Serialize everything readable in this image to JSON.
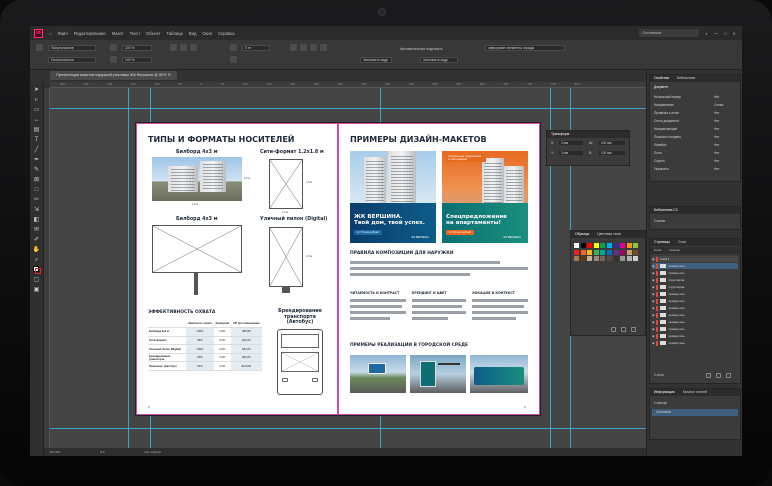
{
  "app": {
    "logo_text": "Id",
    "menu": [
      "Файл",
      "Редактирование",
      "Макет",
      "Текст",
      "Объект",
      "Таблица",
      "Вид",
      "Окно",
      "Справка"
    ],
    "workspace": "Основные"
  },
  "control_bar": {
    "field1": "Полуполосное",
    "field2": "Полуполосное",
    "check1": "Автоматически подгонять",
    "check2": "Заполнить кадр",
    "size_field": "Заполнить кадр",
    "stroke_field": "0 пт",
    "percent": "100 %",
    "frame_label": "сверхузкие элементы ограды"
  },
  "document": {
    "tab_title": "Презентация макетов наружной рекламы ЖК Вершина @ 50%",
    "ruler_ticks": [
      "300",
      "250",
      "200",
      "150",
      "100",
      "50",
      "0",
      "50",
      "100",
      "150",
      "200",
      "250",
      "300",
      "350",
      "400",
      "450",
      "500",
      "550",
      "600",
      "650",
      "700",
      "750",
      "800"
    ]
  },
  "left_page": {
    "title": "ТИПЫ И ФОРМАТЫ НОСИТЕЛЕЙ",
    "billboard_1": "Билборд 4x3 м",
    "city_format": "Сити-формат 1.2x1.8 м",
    "billboard_2": "Билборд 4x3 м",
    "street_pylon": "Уличный пилон (Digital)",
    "dim_1": "4,0 м",
    "dim_2": "3,0 м",
    "dim_3": "1,2 м",
    "dim_4": "1,8 м",
    "dim_5": "1,2 м",
    "dim_6": "1,8 м",
    "efficiency_title": "ЭФФЕКТИВНОСТЬ ОХВАТА",
    "transport_title": "Брендирование транспорта (Автобус)",
    "table": {
      "headers": [
        "",
        "Заметность охвата",
        "Конверсия",
        "CPI при охватывании"
      ],
      "rows": [
        [
          "Билборд 6x3 м",
          "100%",
          "0,8%",
          "$55,88"
        ],
        [
          "Сити-формат",
          "55%",
          "0,6%",
          "$12,00"
        ],
        [
          "Уличный пилон (Digital)",
          "100%",
          "0,6%",
          "$54,00"
        ],
        [
          "Брендирование транспорта",
          "50%",
          "0,4%",
          "$34,00"
        ],
        [
          "Транспорт (Автобус)",
          "51%",
          "0,4%",
          "$110,00"
        ]
      ]
    },
    "page_number": "8"
  },
  "right_page": {
    "title": "ПРИМЕРЫ ДИЗАЙН-МАКЕТОВ",
    "poster_1_title": "ЖК ВЕРШИНА.\nТвой дом, твой успех.",
    "poster_1_sub": "от 7,5 млн рублей",
    "poster_1_logo": "ЖК ВЕРШИНА",
    "poster_2_tag": "Специальное предложение от застройщика",
    "poster_2_title": "Спецпредложение\nна апартаменты!",
    "poster_2_sub": "от 4,5 млн рублей",
    "poster_2_logo": "ЖК ВЕРШИНА",
    "rules_title": "ПРАВИЛА КОМПОЗИЦИИ ДЛЯ НАРУЖКИ",
    "col_1": "ЧИТАЕМОСТЬ И КОНТРАСТ",
    "col_2": "БРЕНДИНГ И ЦВЕТ",
    "col_3": "ЛОКАЦИЯ И КОНТЕКСТ",
    "city_title": "ПРИМЕРЫ РЕАЛИЗАЦИИ В ГОРОДСКОЙ СРЕДЕ",
    "page_number": "9"
  },
  "status": {
    "zoom": "50,18%",
    "page": "8-9",
    "preflight": "Нет ошибок"
  },
  "transform_panel": {
    "title": "Трансформ.",
    "x_label": "X:",
    "x_value": "3 мм",
    "y_label": "Y:",
    "y_value": "3 мм",
    "w_label": "Ш:",
    "w_value": "100 мм",
    "h_label": "В:",
    "h_value": "100 мм"
  },
  "swatches_panel": {
    "tab_1": "Образцы",
    "tab_2": "Цветовая тема",
    "colors": [
      "#ffffff",
      "#000000",
      "#ff0000",
      "#ffff00",
      "#00a651",
      "#00aeef",
      "#2e3192",
      "#ec008c",
      "#f7941d",
      "#8dc63f",
      "#ee1d23",
      "#f26522",
      "#fdb813",
      "#39b54a",
      "#00a99d",
      "#0072bc",
      "#662d91",
      "#9e005d",
      "#c69c6d",
      "#754c24",
      "#a67c52",
      "#603913",
      "#c7b299",
      "#998675",
      "#736357",
      "#534741",
      "#362f2d",
      "#959595",
      "#b2b2b2",
      "#d0d0d0"
    ]
  },
  "properties_panel": {
    "tabs": [
      "Свойства",
      "Библиотеки"
    ],
    "section": "Документ",
    "rows": [
      {
        "label": "Начальный номер",
        "value": "Нет"
      },
      {
        "label": "Направление",
        "value": "Слева"
      },
      {
        "label": "Привязка к сетке",
        "value": "Нет"
      },
      {
        "label": "Сетка документа",
        "value": "Нет"
      },
      {
        "label": "Направляющие",
        "value": "Нет"
      },
      {
        "label": "Показать направл.",
        "value": "Нет"
      },
      {
        "label": "Линейки",
        "value": "Нет"
      },
      {
        "label": "Поля",
        "value": "Нет"
      },
      {
        "label": "Скрыть",
        "value": "Нет"
      },
      {
        "label": "Указатель",
        "value": "Нет"
      }
    ]
  },
  "cc_libraries": "Библиотеки СС",
  "links_label": "Ссылки",
  "layers_panel": {
    "tabs": [
      "Страницы",
      "Слои"
    ],
    "sub_tabs": [
      "Слои",
      "Ссылки"
    ],
    "rows": [
      "Слой 1",
      "прямоуголь.",
      "прямоуголь.",
      "сгруппиров.",
      "сгруппиров.",
      "прямоуголь.",
      "прямоуголь.",
      "прямоуголь.",
      "прямоуголь.",
      "прямоуголь.",
      "прямоуголь.",
      "прямоуголь.",
      "прямоуголь."
    ],
    "footer": "2 слоя"
  },
  "info_panel": {
    "tabs": [
      "Информация",
      "Каталог стилей"
    ],
    "rows": [
      "1 мастер",
      "Заголовок"
    ]
  }
}
